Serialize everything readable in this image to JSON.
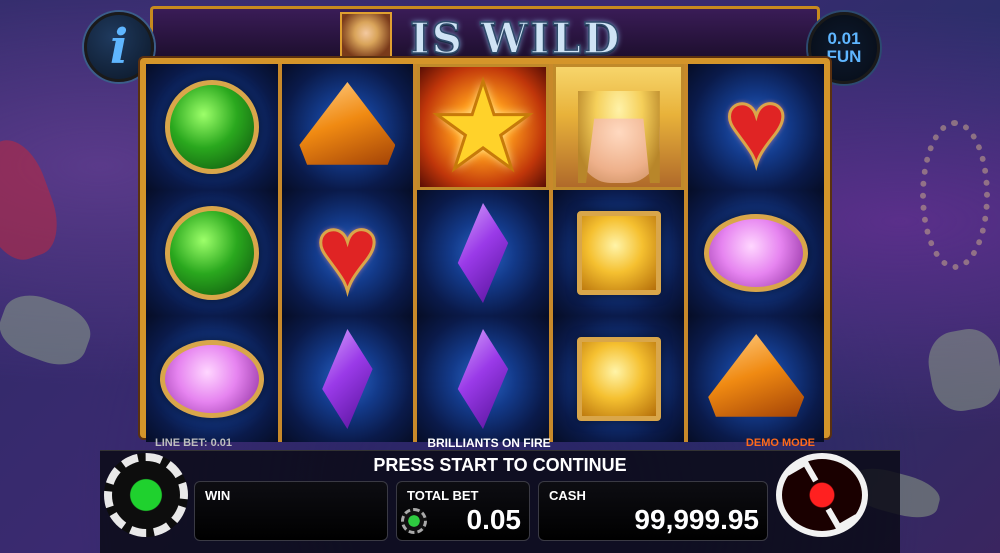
{
  "header": {
    "title": "IS WILD",
    "info_icon": "i",
    "coin_value": "0.01",
    "coin_currency": "FUN"
  },
  "reels": [
    [
      "green-round",
      "green-round",
      "pink-oval"
    ],
    [
      "orange-trillion",
      "red-heart",
      "purple-marquise"
    ],
    [
      "gold-star",
      "purple-marquise",
      "purple-marquise"
    ],
    [
      "blonde-wild",
      "yellow-square",
      "yellow-square"
    ],
    [
      "red-heart",
      "pink-oval",
      "orange-trillion"
    ]
  ],
  "strip": {
    "line_bet": "LINE BET: 0.01",
    "game_name": "BRILLIANTS ON FIRE",
    "mode": "DEMO MODE"
  },
  "panel": {
    "message": "PRESS START TO CONTINUE",
    "win_label": "WIN",
    "win_value": "",
    "total_bet_label": "TOTAL BET",
    "total_bet_value": "0.05",
    "cash_label": "CASH",
    "cash_value": "99,999.95"
  },
  "colors": {
    "frame_gold": "#d4952a",
    "info_blue": "#5fb6ff",
    "demo_orange": "#ff6a1a",
    "button_green": "#1fd12e",
    "spin_red": "#ff2020"
  },
  "icons": {
    "settings": "gear-icon",
    "spin": "refresh-spin-icon",
    "bet_settings": "small-gear-icon"
  }
}
